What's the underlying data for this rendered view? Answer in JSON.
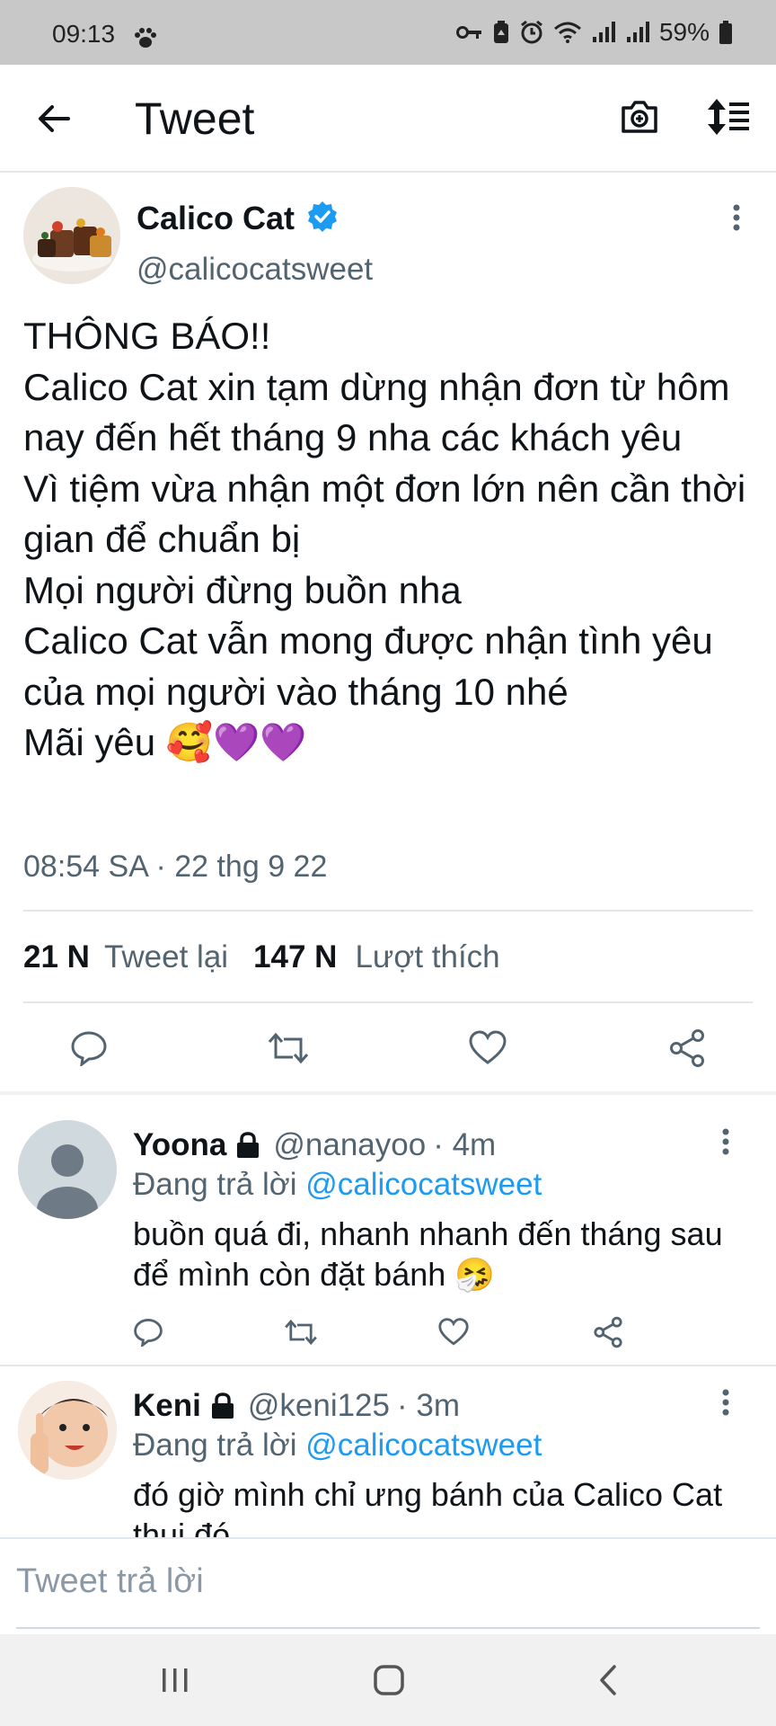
{
  "status_bar": {
    "time": "09:13",
    "battery": "59%",
    "icons": [
      "paw-icon",
      "key-icon",
      "battery-saver-icon",
      "alarm-icon",
      "wifi-icon",
      "signal-icon",
      "signal-icon",
      "battery-icon"
    ]
  },
  "app_bar": {
    "title": "Tweet",
    "icons": [
      "back-arrow-icon",
      "camera-add-icon",
      "sort-icon"
    ]
  },
  "tweet": {
    "author_name": "Calico Cat",
    "verified": true,
    "handle": "@calicocatsweet",
    "text": "THÔNG BÁO!!\nCalico Cat xin tạm dừng nhận đơn từ hôm nay đến hết tháng 9 nha các khách yêu\nVì tiệm vừa nhận một đơn lớn nên cần thời gian để chuẩn bị\nMọi người đừng buồn nha\nCalico Cat vẫn mong được nhận tình yêu của mọi người vào tháng 10 nhé\nMãi yêu 🥰💜💜",
    "meta": "08:54 SA · 22 thg 9 22",
    "retweet_count": "21 N",
    "retweet_label": "Tweet lại",
    "like_count": "147 N",
    "like_label": "Lượt thích"
  },
  "replies": [
    {
      "name": "Yoona",
      "handle": "@nanayoo",
      "time": "· 4m",
      "reply_prefix": "Đang trả lời",
      "reply_to": "@calicocatsweet",
      "text": "buồn quá đi, nhanh nhanh đến tháng sau để mình còn đặt bánh 🤧"
    },
    {
      "name": "Keni",
      "handle": "@keni125",
      "time": "· 3m",
      "reply_prefix": "Đang trả lời",
      "reply_to": "@calicocatsweet",
      "text": "đó giờ mình chỉ ưng bánh của Calico Cat thui đó"
    }
  ],
  "compose": {
    "placeholder": "Tweet trả lời"
  },
  "colors": {
    "accent": "#1d9bf0",
    "secondary_text": "#536471",
    "divider": "#e6e6e6"
  }
}
